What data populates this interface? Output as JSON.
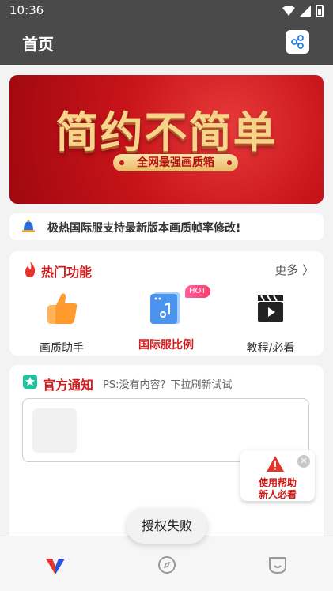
{
  "status_bar": {
    "time": "10:36"
  },
  "app_bar": {
    "title": "首页",
    "share_icon": "share-icon"
  },
  "banner": {
    "headline": "简约不简单",
    "subline": "全网最强画质箱"
  },
  "notice": {
    "text": "极热国际服支持最新版本画质帧率修改!"
  },
  "hot_features": {
    "title": "热门功能",
    "more": "更多 〉",
    "items": [
      {
        "label": "画质助手",
        "icon": "thumbs-up-icon"
      },
      {
        "label": "国际服比例",
        "icon": "music-app-icon",
        "badge": "HOT"
      },
      {
        "label": "教程/必看",
        "icon": "video-clapper-icon"
      }
    ]
  },
  "official_notice": {
    "title": "官方通知",
    "hint": "PS:没有内容？下拉刷新试试"
  },
  "floating_help": {
    "line1": "使用帮助",
    "line2": "新人必看"
  },
  "toast": {
    "text": "授权失败"
  },
  "tabbar": {
    "items": [
      "home-logo-icon",
      "compass-icon",
      "profile-icon"
    ]
  },
  "colors": {
    "accent_red": "#d21b1b",
    "appbar": "#4a4a4a",
    "banner_gold": "#f6d58a"
  }
}
